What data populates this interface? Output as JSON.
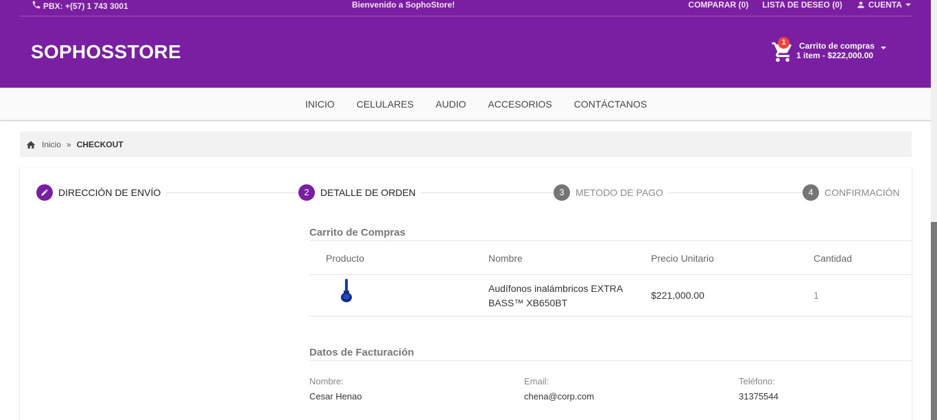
{
  "topbar": {
    "phone": "PBX: +(57) 1 743 3001",
    "welcome": "Bienvenido a SophoStore!",
    "compare": "COMPARAR (0)",
    "wishlist": "LISTA DE DESEO (0)",
    "account": "CUENTA",
    "bg_color": "#7b1fa2"
  },
  "brand": "SOPHOSSTORE",
  "cart": {
    "badge": "1",
    "title": "Carrito de compras",
    "summary": "1 item - $222,000.00"
  },
  "nav": {
    "items": [
      "INICIO",
      "CELULARES",
      "AUDIO",
      "ACCESORIOS",
      "CONTÁCTANOS"
    ]
  },
  "breadcrumb": {
    "home": "Inicio",
    "separator": "»",
    "current": "CHECKOUT"
  },
  "stepper": {
    "steps": [
      {
        "number": "",
        "label": "DIRECCIÓN DE ENVÍO",
        "state": "done"
      },
      {
        "number": "2",
        "label": "DETALLE DE ORDEN",
        "state": "active"
      },
      {
        "number": "3",
        "label": "METODO DE PAGO",
        "state": "inactive"
      },
      {
        "number": "4",
        "label": "CONFIRMACIÓN",
        "state": "inactive"
      }
    ]
  },
  "cart_section": {
    "title": "Carrito de Compras",
    "headers": [
      "Producto",
      "Nombre",
      "Precio Unitario",
      "Cantidad"
    ],
    "rows": [
      {
        "name_line1": "Audífonos inalámbricos EXTRA",
        "name_line2": "BASS™ XB650BT",
        "price": "$221,000.00",
        "quantity": "1"
      }
    ]
  },
  "billing": {
    "title": "Datos de Facturación",
    "name_label": "Nombre:",
    "name_value": "Cesar Henao",
    "email_label": "Email:",
    "email_value": "chena@corp.com",
    "phone_label": "Teléfono:",
    "phone_value": "31375544"
  }
}
